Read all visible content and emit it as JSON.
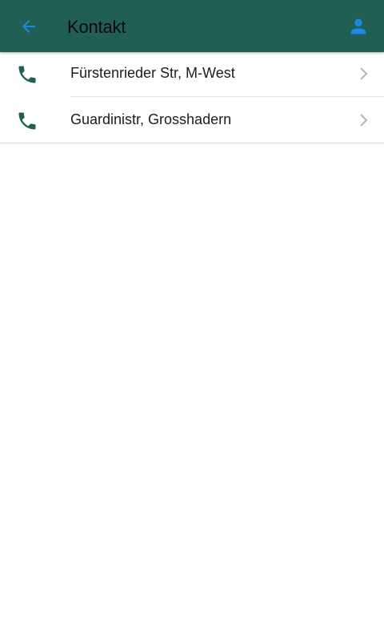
{
  "header": {
    "title": "Kontakt",
    "back_icon": "arrow-left-icon",
    "profile_icon": "user-icon",
    "background_color": "#215e54",
    "accent_color": "#1e88e5"
  },
  "contacts": {
    "items": [
      {
        "label": "Fürstenrieder Str, M-West",
        "icon": "phone-icon"
      },
      {
        "label": "Guardinistr, Grosshadern",
        "icon": "phone-icon"
      }
    ]
  }
}
